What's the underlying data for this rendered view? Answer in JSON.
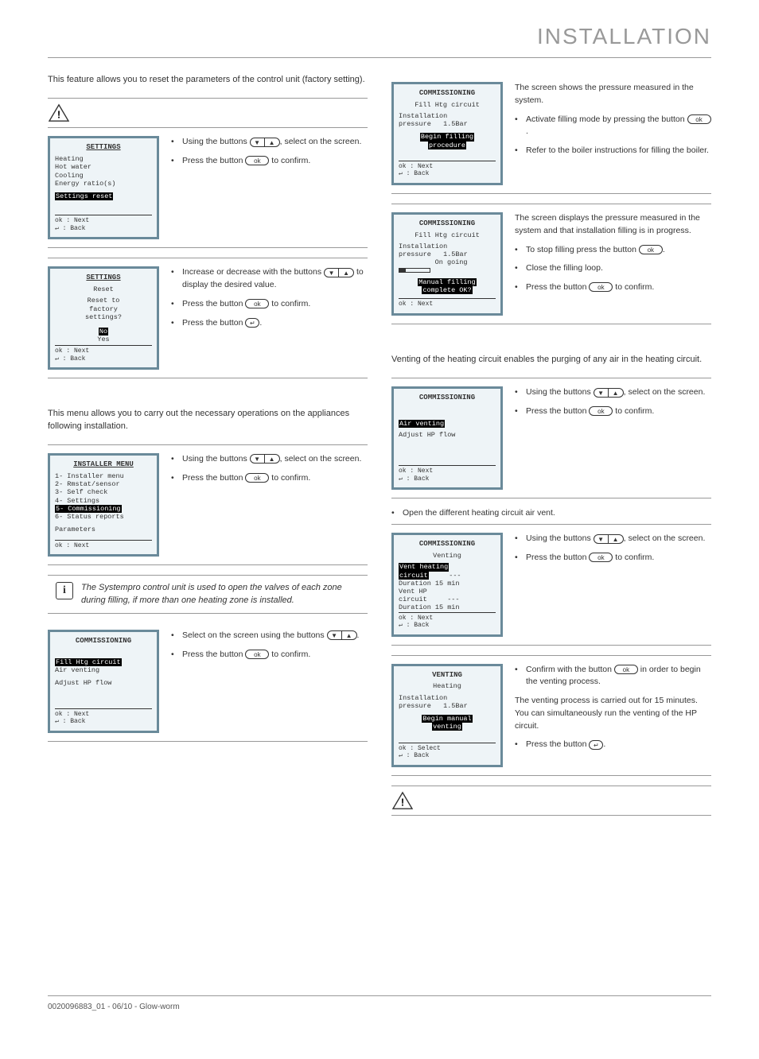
{
  "header": {
    "title": "INSTALLATION"
  },
  "footer": {
    "left": "0020096883_01 - 06/10 - Glow-worm",
    "right": ""
  },
  "left": {
    "intro1": "This feature allows you to reset the parameters of the control unit (factory setting).",
    "screen1": {
      "title": "SETTINGS",
      "lines": [
        "Heating",
        "Hot water",
        "Cooling",
        "Energy ratio(s)"
      ],
      "hl": "Settings reset",
      "footer1": "ok  : Next",
      "footer2": "↵   : Back"
    },
    "instr1a": "Using the buttons ",
    "instr1b": ", select",
    "instr1c": " on the screen.",
    "instr1d": "Press the button ",
    "instr1e": " to confirm.",
    "screen2": {
      "title": "SETTINGS",
      "sub": "Reset",
      "lines": [
        "Reset to",
        "factory",
        "settings?"
      ],
      "hl": "No",
      "after": "Yes",
      "footer1": "ok  : Next",
      "footer2": "↵   : Back"
    },
    "instr2a": "Increase or decrease with the buttons ",
    "instr2b": " to display the desired value.",
    "instr2c": "Press the button ",
    "instr2d": " to confirm.",
    "instr2e": "Press the button ",
    "intro2": "This menu allows you to carry out the necessary operations on the appliances following installation.",
    "screen3": {
      "title": "INSTALLER MENU",
      "lines": [
        "1- Installer menu",
        "2- Rmstat/sensor",
        "3- Self check",
        "4- Settings"
      ],
      "hl": "5- Commissioning",
      "after": "6- Status reports",
      "extra": "Parameters",
      "footer1": "ok  : Next"
    },
    "instr3a": "Using the buttons ",
    "instr3b": ", select ",
    "instr3c": " on the screen.",
    "instr3d": "Press the button ",
    "instr3e": " to confirm.",
    "info": "The Systempro control unit is used to open the valves of each zone during filling, if more than one heating zone is installed.",
    "screen4": {
      "title": "COMMISSIONING",
      "hl": "Fill Htg circuit",
      "lines": [
        "Air venting",
        "",
        "Adjust HP flow"
      ],
      "footer1": "ok  : Next",
      "footer2": "↵   : Back"
    },
    "instr4a": "Select ",
    "instr4b": " on the screen using the buttons ",
    "instr4c": "Press the button ",
    "instr4d": " to confirm."
  },
  "right": {
    "screen5": {
      "title": "COMMISSIONING",
      "sub": "Fill Htg circuit",
      "lines": [
        "Installation",
        "pressure   1.5Bar"
      ],
      "hl1": "Begin filling",
      "hl2": "procedure",
      "footer1": "ok  : Next",
      "footer2": "↵   : Back"
    },
    "instr5a": "The screen shows the pressure measured in the system.",
    "instr5b": "Activate filling mode by pressing the button ",
    "instr5c": "Refer to the boiler instructions for filling the boiler.",
    "screen6": {
      "title": "COMMISSIONING",
      "sub": "Fill Htg circuit",
      "lines": [
        "Installation",
        "pressure   1.5Bar",
        "  On going"
      ],
      "hl1": "Manual filling",
      "hl2": "complete OK?",
      "footer1": "ok  : Next"
    },
    "instr6a": "The screen displays the pressure measured in the system and that installation filling is in progress.",
    "instr6b": "To stop filling press the button ",
    "instr6c": "Close the filling loop.",
    "instr6d": "Press the button ",
    "instr6e": " to confirm.",
    "intro3": "Venting of the heating circuit enables the purging of any air in the heating circuit.",
    "screen7": {
      "title": "COMMISSIONING",
      "hl": "Air venting",
      "lines": [
        "Adjust HP flow"
      ],
      "footer1": "ok  : Next",
      "footer2": "↵   : Back"
    },
    "instr7a": "Using the buttons ",
    "instr7b": ", select ",
    "instr7c": " on the screen.",
    "instr7d": "Press the button ",
    "instr7e": " to confirm.",
    "free1": "Open the different heating circuit air vent.",
    "screen8": {
      "title": "COMMISSIONING",
      "sub": "Venting",
      "hl1": "Vent heating",
      "hl2": "circuit",
      "lines": [
        "Duration 15 min",
        "Vent HP",
        "circuit     ---",
        "Duration 15 min"
      ],
      "dash": "---",
      "footer1": "ok  : Next",
      "footer2": "↵   : Back"
    },
    "instr8a": "Using the buttons ",
    "instr8b": ", select ",
    "instr8c": " on the screen.",
    "instr8d": "Press the button ",
    "instr8e": " to confirm.",
    "screen9": {
      "title": "VENTING",
      "sub": "Heating",
      "lines": [
        "Installation",
        "pressure   1.5Bar"
      ],
      "hl1": "Begin manual",
      "hl2": "venting",
      "footer1": "ok  : Select",
      "footer2": "↵   : Back"
    },
    "instr9a": "Confirm with the button ",
    "instr9b": " in order to begin the venting process.",
    "instr9c": "The venting process is carried out for 15 minutes. You can simultaneously run the venting of the HP circuit.",
    "instr9d": "Press the button "
  },
  "ok_label": "ok",
  "back_label": "↵",
  "down_label": "▼",
  "up_label": "▲"
}
